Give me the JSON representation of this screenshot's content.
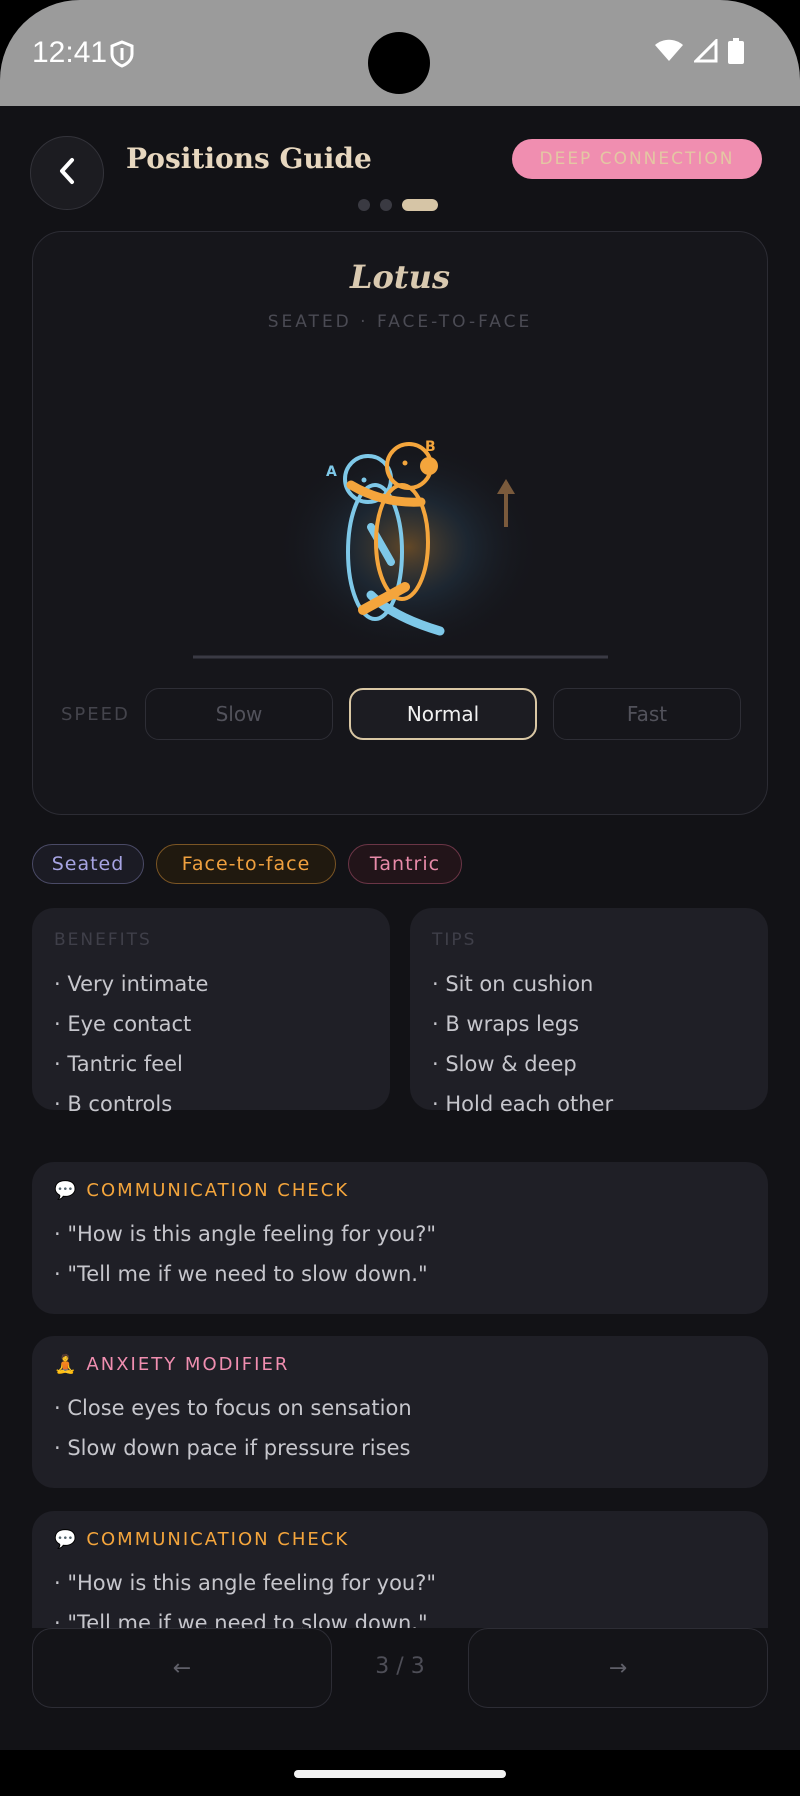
{
  "status": {
    "time": "12:41"
  },
  "header": {
    "title": "Positions Guide",
    "badge": "DEEP CONNECTION"
  },
  "position": {
    "name": "Lotus",
    "subtitle": "SEATED · FACE-TO-FACE"
  },
  "figure_labels": {
    "a": "A",
    "b": "B"
  },
  "speed": {
    "label": "SPEED",
    "options": [
      "Slow",
      "Normal",
      "Fast"
    ],
    "selected": "Normal"
  },
  "tags": [
    "Seated",
    "Face-to-face",
    "Tantric"
  ],
  "benefits": {
    "heading": "BENEFITS",
    "items": [
      "· Very intimate",
      "· Eye contact",
      "· Tantric feel",
      "· B controls"
    ]
  },
  "tips": {
    "heading": "TIPS",
    "items": [
      "· Sit on cushion",
      "· B wraps legs",
      "· Slow & deep",
      "· Hold each other"
    ]
  },
  "communication": {
    "icon": "💬",
    "heading": "COMMUNICATION CHECK",
    "items": [
      "· \"How is this angle feeling for you?\"",
      "· \"Tell me if we need to slow down.\""
    ]
  },
  "anxiety": {
    "icon": "🧘",
    "heading": "ANXIETY MODIFIER",
    "items": [
      "· Close eyes to focus on sensation",
      "· Slow down pace if pressure rises"
    ]
  },
  "communication2": {
    "icon": "💬",
    "heading": "COMMUNICATION CHECK",
    "items": [
      "· \"How is this angle feeling for you?\"",
      "· \"Tell me if we need to slow down.\""
    ]
  },
  "nav": {
    "prev": "←",
    "next": "→",
    "pager": "3 / 3"
  },
  "colors": {
    "accent": "#d9c7a4",
    "orange": "#f4a53c",
    "blue": "#7ec8e8",
    "pink": "#f08eb0",
    "lavender": "#a7a4e3"
  }
}
